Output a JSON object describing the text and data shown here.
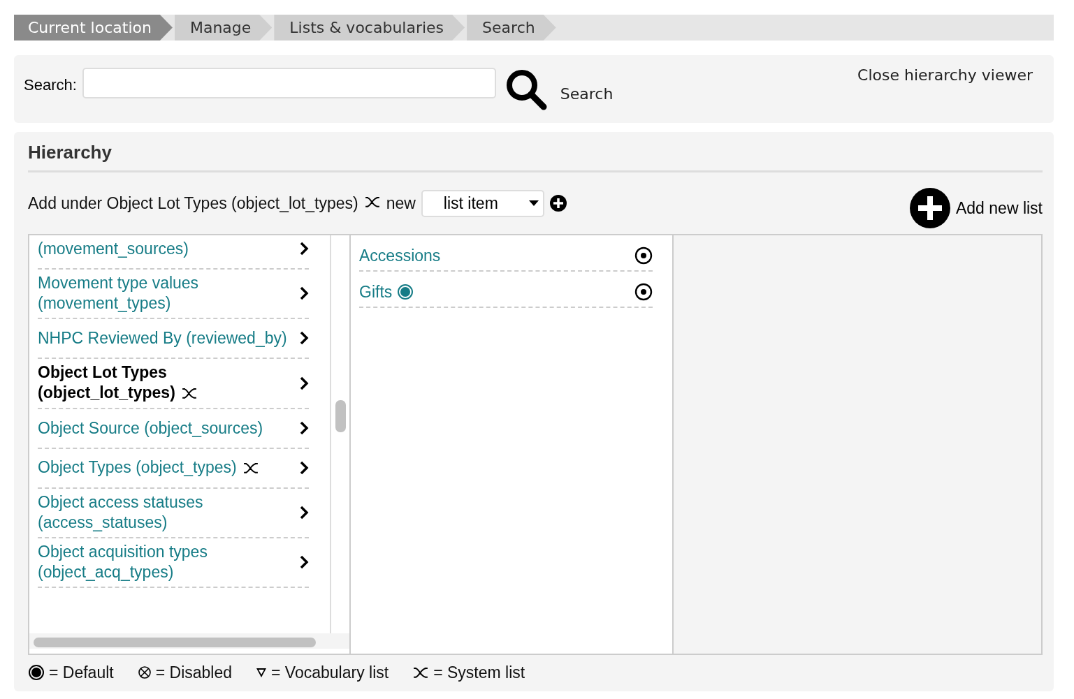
{
  "breadcrumbs": [
    {
      "label": "Current location",
      "kind": "current"
    },
    {
      "label": "Manage",
      "kind": "link"
    },
    {
      "label": "Lists & vocabularies",
      "kind": "link"
    },
    {
      "label": "Search",
      "kind": "link"
    }
  ],
  "search": {
    "label": "Search:",
    "button": "Search",
    "close": "Close hierarchy viewer"
  },
  "hierarchy": {
    "title": "Hierarchy",
    "add_prefix": "Add under Object Lot Types (object_lot_types)",
    "add_system": true,
    "add_new": "new",
    "type_select": "list item",
    "add_new_list": "Add new list"
  },
  "lists": [
    {
      "label": "(movement_sources)",
      "system": false,
      "selected": false
    },
    {
      "label": "Movement type values (movement_types)",
      "system": false,
      "selected": false
    },
    {
      "label": "NHPC Reviewed By (reviewed_by)",
      "system": false,
      "selected": false
    },
    {
      "label": "Object Lot Types (object_lot_types)",
      "system": true,
      "selected": true
    },
    {
      "label": "Object Source (object_sources)",
      "system": false,
      "selected": false
    },
    {
      "label": "Object Types (object_types)",
      "system": true,
      "selected": false
    },
    {
      "label": "Object access statuses (access_statuses)",
      "system": false,
      "selected": false
    },
    {
      "label": "Object acquisition types (object_acq_types)",
      "system": false,
      "selected": false
    }
  ],
  "items": [
    {
      "label": "Accessions",
      "default": false
    },
    {
      "label": "Gifts",
      "default": true
    }
  ],
  "legend": [
    {
      "kind": "default",
      "label": "= Default"
    },
    {
      "kind": "disabled",
      "label": "= Disabled"
    },
    {
      "kind": "vocabulary",
      "label": "= Vocabulary list"
    },
    {
      "kind": "system",
      "label": "= System list"
    }
  ]
}
